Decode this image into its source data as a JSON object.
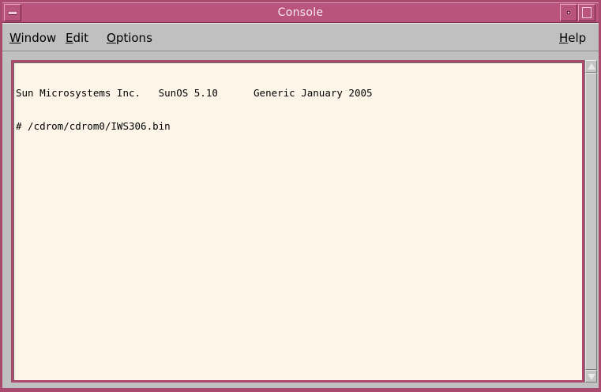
{
  "window": {
    "title": "Console",
    "menu_button_icon": "window-menu-icon",
    "minimize_icon": "minimize-icon",
    "maximize_icon": "maximize-icon",
    "title_color": "#b8547d",
    "frame_color": "#a94a6e"
  },
  "menubar": {
    "window": {
      "mnemonic": "W",
      "rest": "indow"
    },
    "edit": {
      "mnemonic": "E",
      "rest": "dit"
    },
    "options": {
      "mnemonic": "O",
      "rest": "ptions"
    },
    "help": {
      "mnemonic": "H",
      "rest": "elp"
    }
  },
  "console": {
    "lines": [
      "Sun Microsystems Inc.   SunOS 5.10      Generic January 2005",
      "# /cdrom/cdrom0/IWS306.bin"
    ],
    "background": "#fdf6e8"
  },
  "scrollbar": {
    "up_icon": "scroll-up-arrow-icon",
    "down_icon": "scroll-down-arrow-icon"
  }
}
